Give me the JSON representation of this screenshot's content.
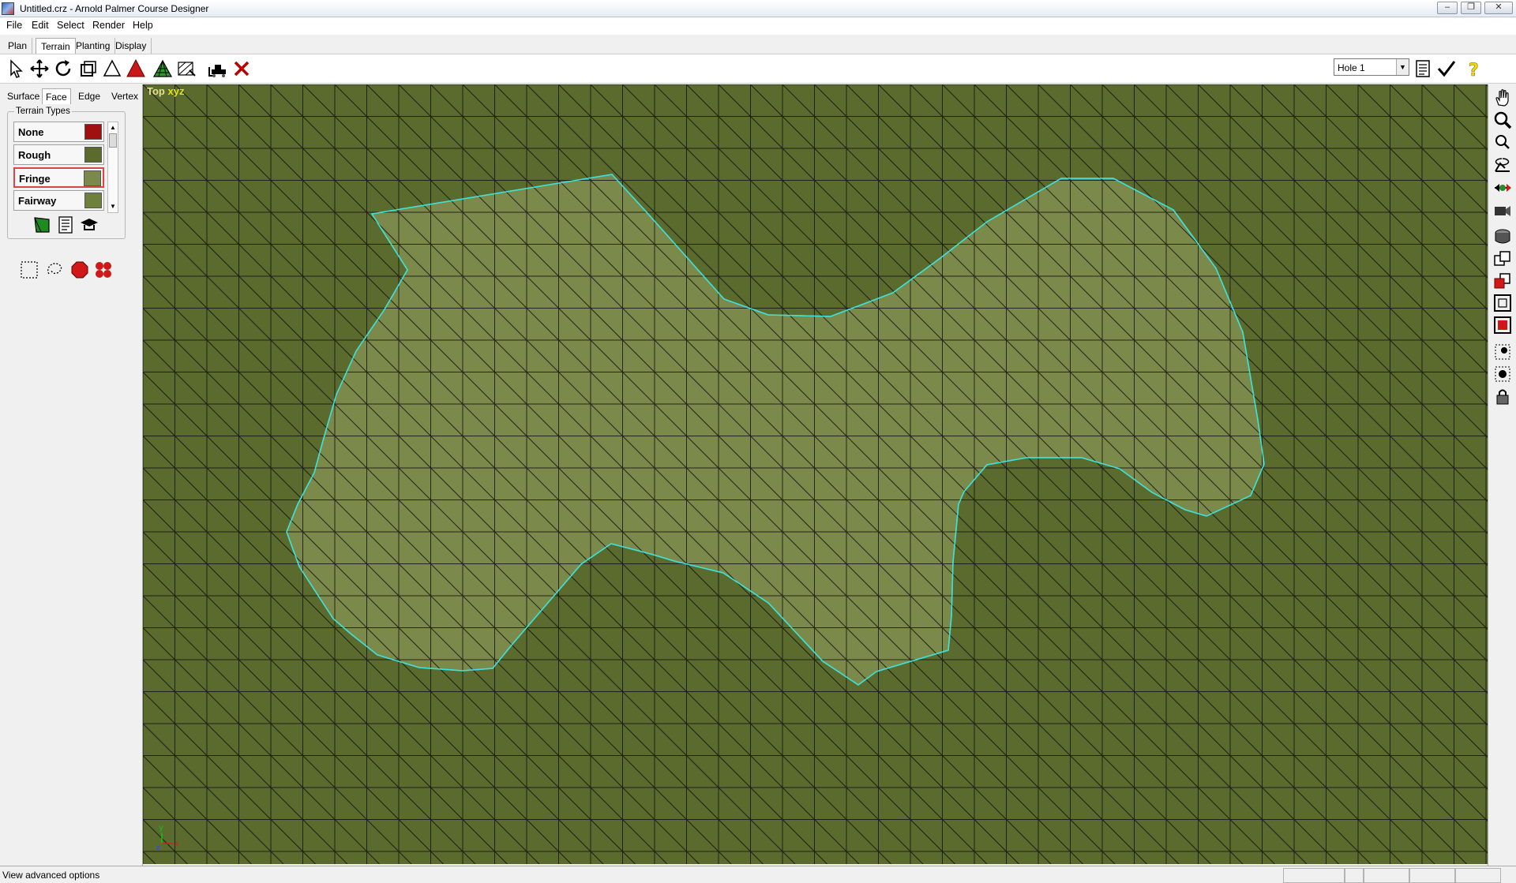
{
  "window": {
    "title": "Untitled.crz - Arnold Palmer Course Designer",
    "controls": [
      "minimize",
      "restore",
      "close"
    ]
  },
  "menu": [
    "File",
    "Edit",
    "Select",
    "Render",
    "Help"
  ],
  "mode_tabs": {
    "items": [
      "Plan",
      "Terrain",
      "Planting",
      "Display"
    ],
    "active": "Terrain"
  },
  "toolbar": {
    "tools": [
      "select-arrow-icon",
      "move-icon",
      "rotate-icon",
      "scale-icon",
      "triangle-outline-icon",
      "triangle-filled-icon",
      "terrain-mesh-icon",
      "terrain-edit-icon",
      "bulldozer-icon",
      "delete-x-icon"
    ],
    "hole_select": "Hole 1",
    "right_icons": [
      "notes-icon",
      "checkmark-icon",
      "help-icon"
    ]
  },
  "left_panel": {
    "subtabs": [
      "Surface",
      "Face",
      "Edge",
      "Vertex"
    ],
    "active_subtab": "Face",
    "terrain_group_label": "Terrain Types",
    "terrain_types": [
      {
        "name": "None",
        "color": "#a01010"
      },
      {
        "name": "Rough",
        "color": "#5b6a2d"
      },
      {
        "name": "Fringe",
        "color": "#7b8a4a",
        "selected": true
      },
      {
        "name": "Fairway",
        "color": "#6f7f3c"
      }
    ],
    "group_buttons": [
      "leaf-icon",
      "texture-icon",
      "graduation-icon"
    ],
    "selection_buttons": [
      "rect-select-icon",
      "lasso-select-icon",
      "octagon-select-icon",
      "multi-select-icon"
    ]
  },
  "viewport": {
    "view_name": "Top",
    "axes_label": "xyz",
    "colors": {
      "rough": "#5b6a2d",
      "fringe": "#7b8a4a",
      "mesh": "#111111",
      "boundary": "#3fe0d8"
    }
  },
  "right_toolbar": [
    "hand-pan-icon",
    "zoom-icon",
    "zoom-small-icon",
    "orbit-icon",
    "move-camera-icon",
    "camera-icon",
    "disk-icon",
    "layers-icon",
    "red-layer-icon",
    "frame-icon",
    "red-frame-icon",
    "cursor-target-icon",
    "target-icon",
    "lock-icon"
  ],
  "status": {
    "message": "View advanced options"
  }
}
